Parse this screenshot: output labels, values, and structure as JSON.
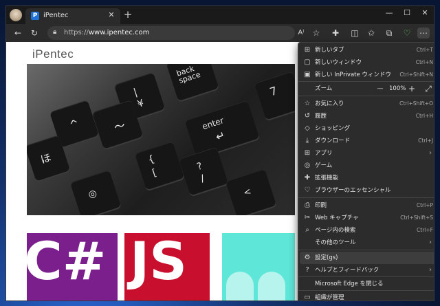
{
  "browser": {
    "tab_title": "iPentec",
    "tab_icon_letter": "P",
    "tab_close": "✕",
    "new_tab": "+",
    "window_controls": {
      "minimize": "—",
      "maximize": "☐",
      "close": "✕"
    },
    "url_prefix": "https://",
    "url_domain": "www.ipentec.com"
  },
  "page": {
    "logo": "iPentec",
    "hero_keys": {
      "backspace": "back space",
      "enter": "enter",
      "yen": "¥",
      "bar": "|",
      "brace": "{",
      "bracket": "[",
      "caret": "^",
      "slash": "/",
      "question": "?",
      "ho": "ほ",
      "seven": "7"
    },
    "tiles": [
      {
        "text": "C#",
        "color": "#7a1f8c"
      },
      {
        "text": "JS",
        "color": "#c8102e"
      },
      {
        "text": "",
        "color": "#5ee6d8"
      }
    ]
  },
  "menu": {
    "items": [
      {
        "icon": "new-tab-icon",
        "glyph": "⊞",
        "label": "新しいタブ",
        "shortcut": "Ctrl+T"
      },
      {
        "icon": "new-window-icon",
        "glyph": "▢",
        "label": "新しいウィンドウ",
        "shortcut": "Ctrl+N"
      },
      {
        "icon": "inprivate-icon",
        "glyph": "▣",
        "label": "新しい InPrivate ウィンドウ",
        "shortcut": "Ctrl+Shift+N"
      },
      {
        "icon": "zoom-icon",
        "glyph": "",
        "label": "ズーム",
        "zoom": "100%"
      },
      {
        "icon": "favorites-icon",
        "glyph": "☆",
        "label": "お気に入り",
        "shortcut": "Ctrl+Shift+O"
      },
      {
        "icon": "history-icon",
        "glyph": "↺",
        "label": "履歴",
        "shortcut": "Ctrl+H"
      },
      {
        "icon": "shopping-icon",
        "glyph": "◇",
        "label": "ショッピング",
        "shortcut": ""
      },
      {
        "icon": "download-icon",
        "glyph": "⤓",
        "label": "ダウンロード",
        "shortcut": "Ctrl+J"
      },
      {
        "icon": "apps-icon",
        "glyph": "⊞",
        "label": "アプリ",
        "arrow": "›"
      },
      {
        "icon": "games-icon",
        "glyph": "◎",
        "label": "ゲーム",
        "shortcut": ""
      },
      {
        "icon": "extensions-icon",
        "glyph": "✚",
        "label": "拡張機能",
        "shortcut": ""
      },
      {
        "icon": "essentials-icon",
        "glyph": "♡",
        "label": "ブラウザーのエッセンシャル",
        "shortcut": ""
      },
      {
        "icon": "print-icon",
        "glyph": "⎙",
        "label": "印刷",
        "shortcut": "Ctrl+P"
      },
      {
        "icon": "web-capture-icon",
        "glyph": "✂",
        "label": "Web キャプチャ",
        "shortcut": "Ctrl+Shift+S"
      },
      {
        "icon": "find-icon",
        "glyph": "⌕",
        "label": "ページ内の検索",
        "shortcut": "Ctrl+F"
      },
      {
        "icon": "more-tools-icon",
        "glyph": "",
        "label": "その他のツール",
        "arrow": "›"
      },
      {
        "icon": "settings-icon",
        "glyph": "⚙",
        "label": "設定(gs)",
        "shortcut": ""
      },
      {
        "icon": "help-icon",
        "glyph": "?",
        "label": "ヘルプとフィードバック",
        "arrow": "›"
      },
      {
        "icon": "",
        "glyph": "",
        "label": "Microsoft Edge を閉じる",
        "shortcut": ""
      },
      {
        "icon": "managed-icon",
        "glyph": "▭",
        "label": "組織が管理",
        "shortcut": ""
      }
    ]
  }
}
